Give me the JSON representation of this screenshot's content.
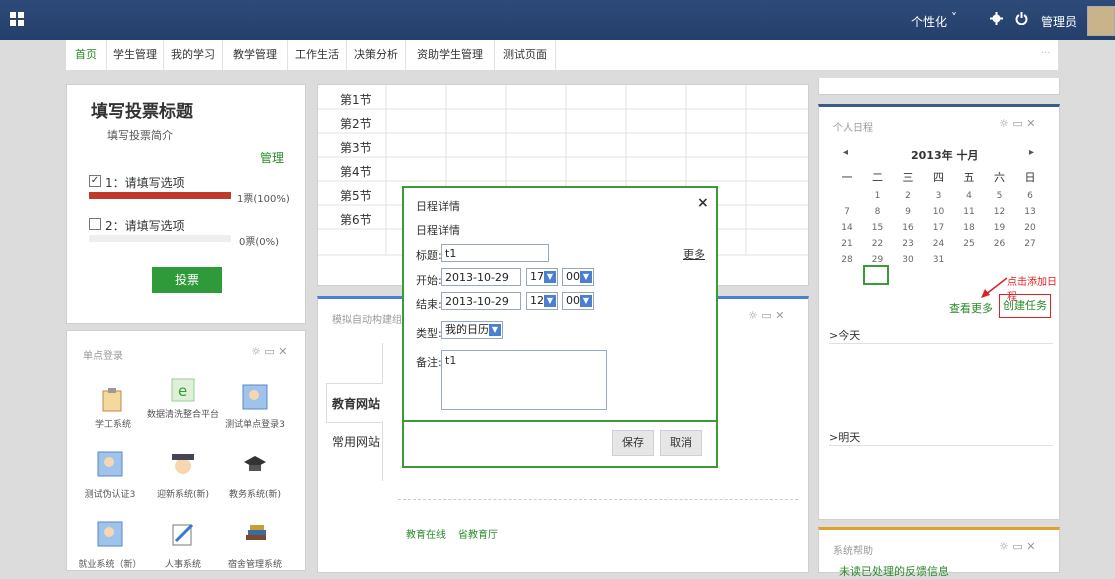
{
  "topbar": {
    "personalize": "个性化",
    "personalize_caret": "˅",
    "admin": "管理员",
    "icons": [
      "grid-icon",
      "gear-icon",
      "power-icon"
    ]
  },
  "nav": {
    "items": [
      "首页",
      "学生管理",
      "我的学习",
      "教学管理",
      "工作生活",
      "决策分析",
      "资助学生管理",
      "测试页面"
    ],
    "more": "···"
  },
  "vote": {
    "title": "填写投票标题",
    "intro": "填写投票简介",
    "manage": "管理",
    "option1": "1：请填写选项",
    "option1_stat": "1票(100%)",
    "option1_fill": 1.0,
    "option2": "2：请填写选项",
    "option2_stat": "0票(0%)",
    "option2_fill": 0.0,
    "vote_button": "投票"
  },
  "schedule": {
    "periods": [
      "第1节",
      "第2节",
      "第3节",
      "第4节",
      "第5节",
      "第6节"
    ]
  },
  "sso": {
    "title": "单点登录",
    "apps": [
      "学工系统",
      "数据清洗整合平台",
      "测试单点登录3",
      "测试伪认证3",
      "迎新系统(新)",
      "教务系统(新)",
      "就业系统（新）",
      "人事系统",
      "宿舍管理系统"
    ]
  },
  "portal": {
    "title": "模拟自动构建组件",
    "tab_edu": "教育网站",
    "tab_common": "常用网站",
    "link1": "教育在线",
    "link2": "省教育厅"
  },
  "calendar": {
    "title": "个人日程",
    "prev": "◂",
    "next": "▸",
    "month": "2013年 十月",
    "weekdays": [
      "一",
      "二",
      "三",
      "四",
      "五",
      "六",
      "日"
    ],
    "weeks": [
      [
        "",
        "1",
        "2",
        "3",
        "4",
        "5",
        "6"
      ],
      [
        "7",
        "8",
        "9",
        "10",
        "11",
        "12",
        "13"
      ],
      [
        "14",
        "15",
        "16",
        "17",
        "18",
        "19",
        "20"
      ],
      [
        "21",
        "22",
        "23",
        "24",
        "25",
        "26",
        "27"
      ],
      [
        "28",
        "29",
        "30",
        "31",
        "",
        "",
        ""
      ]
    ],
    "annotation": "点击添加日程",
    "view_more": "查看更多",
    "create_task": "创建任务",
    "today": ">今天",
    "tomorrow": ">明天"
  },
  "system_panel": {
    "title": "系统帮助",
    "body": "未读已处理的反馈信息"
  },
  "modal": {
    "title": "日程详情",
    "close": "×",
    "subtitle": "日程详情",
    "title_label": "标题:",
    "title_value": "t1",
    "more": "更多",
    "start_label": "开始:",
    "start_date": "2013-10-29",
    "start_hour": "17",
    "start_min": "00",
    "end_label": "结束:",
    "end_date": "2013-10-29",
    "end_hour": "12",
    "end_min": "00",
    "type_label": "类型:",
    "type_value": "我的日历",
    "note_label": "备注:",
    "note_value": "t1",
    "save": "保存",
    "cancel": "取消"
  },
  "colors": {
    "topbar": "#2a4573",
    "accent_green": "#2a8a2a",
    "bar_red": "#c0392b",
    "annotation_red": "#e02020"
  }
}
